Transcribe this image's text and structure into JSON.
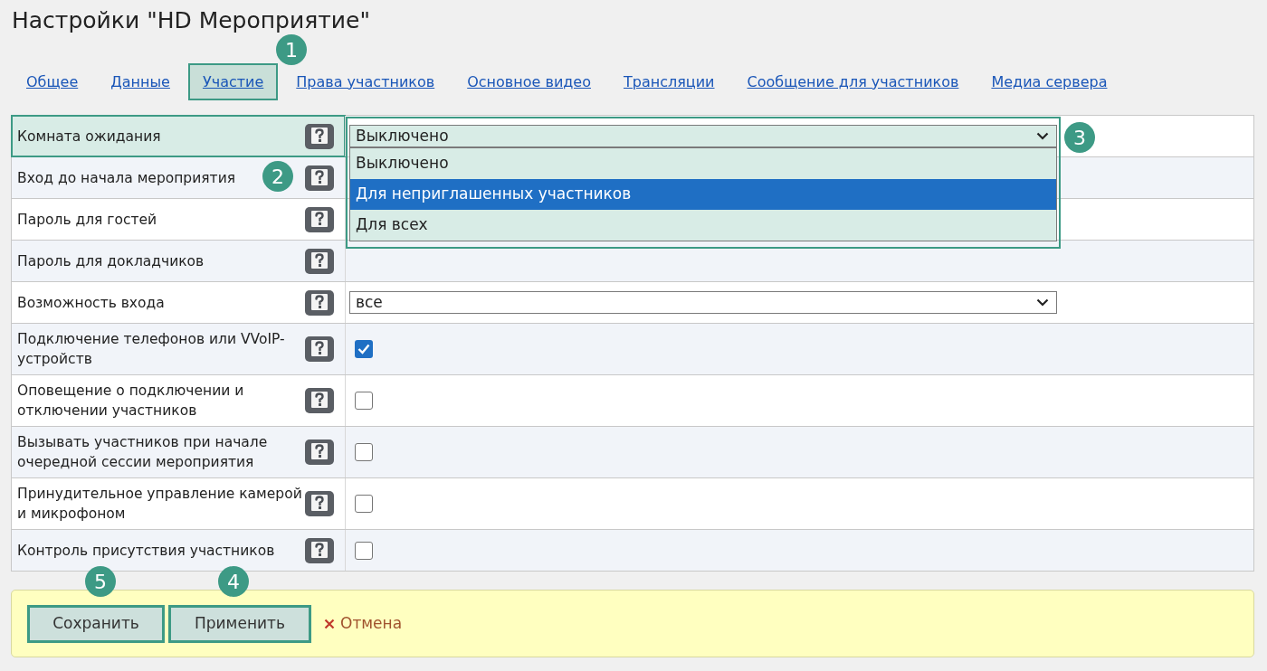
{
  "title": "Настройки \"HD Мероприятие\"",
  "tabs": [
    {
      "label": "Общее",
      "highlighted": false
    },
    {
      "label": "Данные",
      "highlighted": false
    },
    {
      "label": "Участие",
      "highlighted": true
    },
    {
      "label": "Права участников",
      "highlighted": false
    },
    {
      "label": "Основное видео",
      "highlighted": false
    },
    {
      "label": "Трансляции",
      "highlighted": false
    },
    {
      "label": "Сообщение для участников",
      "highlighted": false
    },
    {
      "label": "Медиа сервера",
      "highlighted": false
    }
  ],
  "fields": [
    {
      "label": "Комната ожидания",
      "kind": "select",
      "highlighted": true,
      "value": "Выключено",
      "open": true,
      "options": [
        {
          "label": "Выключено",
          "highlighted": false
        },
        {
          "label": "Для неприглашенных участников",
          "highlighted": true
        },
        {
          "label": "Для всех",
          "highlighted": false
        }
      ]
    },
    {
      "label": "Вход до начала мероприятия",
      "kind": "empty",
      "highlighted": false
    },
    {
      "label": "Пароль для гостей",
      "kind": "empty",
      "highlighted": false
    },
    {
      "label": "Пароль для докладчиков",
      "kind": "empty",
      "highlighted": false
    },
    {
      "label": "Возможность входа",
      "kind": "select",
      "highlighted": false,
      "value": "все",
      "open": false
    },
    {
      "label": "Подключение телефонов или VVoIP-устройств",
      "kind": "checkbox",
      "highlighted": false,
      "checked": true
    },
    {
      "label": "Оповещение о подключении и отключении участников",
      "kind": "checkbox",
      "highlighted": false,
      "checked": false
    },
    {
      "label": "Вызывать участников при начале очередной сессии мероприятия",
      "kind": "checkbox",
      "highlighted": false,
      "checked": false
    },
    {
      "label": "Принудительное управление камерой и микрофоном",
      "kind": "checkbox",
      "highlighted": false,
      "checked": false
    },
    {
      "label": "Контроль присутствия участников",
      "kind": "checkbox",
      "highlighted": false,
      "checked": false
    }
  ],
  "buttons": [
    {
      "label": "Сохранить",
      "highlighted": true
    },
    {
      "label": "Применить",
      "highlighted": true
    }
  ],
  "cancel": "Отмена",
  "callouts": [
    "1",
    "2",
    "3",
    "4",
    "5"
  ]
}
